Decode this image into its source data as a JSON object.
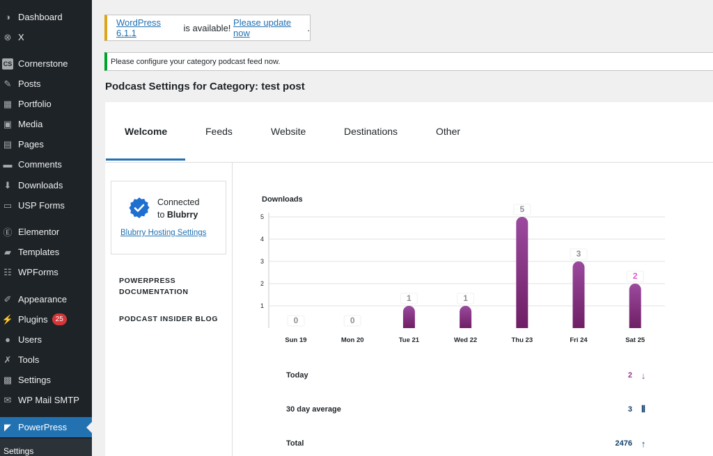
{
  "sidebar": {
    "items": [
      {
        "label": "Dashboard",
        "icon": "dashboard-icon"
      },
      {
        "label": "X",
        "icon": "x-circle-icon"
      },
      {
        "label": "Cornerstone",
        "icon": "cs-icon"
      },
      {
        "label": "Posts",
        "icon": "pin-icon"
      },
      {
        "label": "Portfolio",
        "icon": "portfolio-icon"
      },
      {
        "label": "Media",
        "icon": "media-icon"
      },
      {
        "label": "Pages",
        "icon": "pages-icon"
      },
      {
        "label": "Comments",
        "icon": "comments-icon"
      },
      {
        "label": "Downloads",
        "icon": "download-icon"
      },
      {
        "label": "USP Forms",
        "icon": "forms-icon"
      },
      {
        "label": "Elementor",
        "icon": "elementor-icon"
      },
      {
        "label": "Templates",
        "icon": "folder-icon"
      },
      {
        "label": "WPForms",
        "icon": "wpforms-icon"
      },
      {
        "label": "Appearance",
        "icon": "brush-icon"
      },
      {
        "label": "Plugins",
        "icon": "plug-icon",
        "badge": "25"
      },
      {
        "label": "Users",
        "icon": "user-icon"
      },
      {
        "label": "Tools",
        "icon": "wrench-icon"
      },
      {
        "label": "Settings",
        "icon": "settings-icon"
      },
      {
        "label": "WP Mail SMTP",
        "icon": "mail-icon"
      },
      {
        "label": "PowerPress",
        "icon": "powerpress-icon",
        "active": true
      }
    ],
    "submenu": {
      "label": "Settings"
    }
  },
  "notices": {
    "update": {
      "link1": "WordPress 6.1.1",
      "mid": " is available! ",
      "link2": "Please update now",
      "end": "."
    },
    "info": "Please configure your category podcast feed now."
  },
  "page_title": "Podcast Settings for Category: test post",
  "tabs": [
    "Welcome",
    "Feeds",
    "Website",
    "Destinations",
    "Other"
  ],
  "connect": {
    "line1": "Connected",
    "line2_prefix": "to ",
    "line2_bold": "Blubrry",
    "link": "Blubrry Hosting Settings"
  },
  "side_links": {
    "doc_line1": "POWERPRESS",
    "doc_line2": "DOCUMENTATION",
    "blog": "PODCAST INSIDER BLOG"
  },
  "chart_data": {
    "type": "bar",
    "title": "Downloads",
    "categories": [
      "Sun 19",
      "Mon 20",
      "Tue 21",
      "Wed 22",
      "Thu 23",
      "Fri 24",
      "Sat 25"
    ],
    "values": [
      0,
      0,
      1,
      1,
      5,
      3,
      2
    ],
    "ylim": [
      0,
      5
    ],
    "yticks": [
      1,
      2,
      3,
      4,
      5
    ],
    "grid": true,
    "bar_color_top": "#9b4a9e",
    "bar_color_bottom": "#6e1f64",
    "highlight_label_color": "#e055cf",
    "highlight_index": 6
  },
  "stats": [
    {
      "label": "Today",
      "value": "2",
      "icon": "arrow-down-icon",
      "color": "#8e3a8d"
    },
    {
      "label": "30 day average",
      "value": "3",
      "icon": "waveform-icon",
      "color": "#0f3e6b"
    },
    {
      "label": "Total",
      "value": "2476",
      "icon": "arrow-up-icon",
      "color": "#0f3e6b"
    }
  ]
}
